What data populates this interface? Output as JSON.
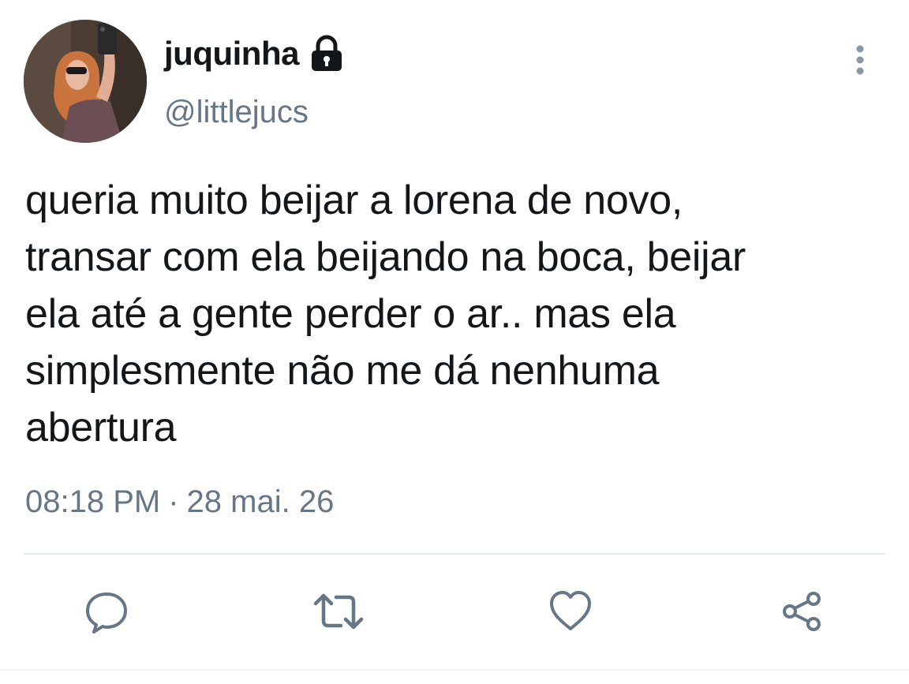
{
  "user": {
    "display_name": "juquinha",
    "handle": "@littlejucs",
    "protected_icon": "lock-icon",
    "avatar_icon": "profile-photo"
  },
  "tweet": {
    "text": "queria muito beijar a lorena de novo,\ntransar com ela beijando na boca, beijar\nela até a gente perder o ar.. mas ela\nsimplesmente não me dá nenhuma\nabertura",
    "time": "08:18 PM",
    "separator": "·",
    "date": "28 mai. 26"
  },
  "actions": [
    {
      "name": "reply",
      "icon": "speech-bubble-icon"
    },
    {
      "name": "retweet",
      "icon": "retweet-icon"
    },
    {
      "name": "like",
      "icon": "heart-icon"
    },
    {
      "name": "share",
      "icon": "share-icon"
    }
  ],
  "menu_icon": "more-vertical-icon",
  "colors": {
    "text": "#14171a",
    "secondary": "#657786",
    "divider": "#e6ecf0"
  }
}
